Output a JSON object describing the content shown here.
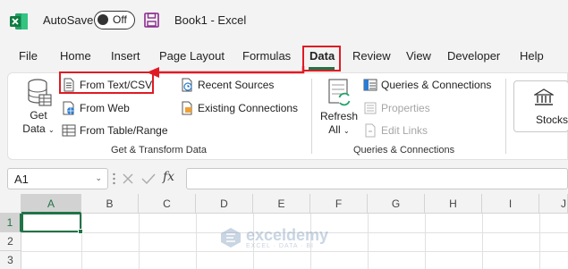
{
  "titlebar": {
    "autosave_label": "AutoSave",
    "autosave_state": "Off",
    "document_title": "Book1  -  Excel"
  },
  "tabs": [
    "File",
    "Home",
    "Insert",
    "Page Layout",
    "Formulas",
    "Data",
    "Review",
    "View",
    "Developer",
    "Help"
  ],
  "active_tab": "Data",
  "ribbon": {
    "get_transform": {
      "get_data_line1": "Get",
      "get_data_line2": "Data",
      "from_text_csv": "From Text/CSV",
      "from_web": "From Web",
      "from_table_range": "From Table/Range",
      "recent_sources": "Recent Sources",
      "existing_connections": "Existing Connections",
      "group_label": "Get & Transform Data"
    },
    "queries": {
      "refresh_line1": "Refresh",
      "refresh_line2": "All",
      "queries_connections": "Queries & Connections",
      "properties": "Properties",
      "edit_links": "Edit Links",
      "group_label": "Queries & Connections"
    },
    "data_types": {
      "stocks": "Stocks"
    }
  },
  "formula_bar": {
    "name_box": "A1",
    "formula_value": ""
  },
  "grid": {
    "columns": [
      "A",
      "B",
      "C",
      "D",
      "E",
      "F",
      "G",
      "H",
      "I",
      "J"
    ],
    "rows": [
      "1",
      "2",
      "3"
    ],
    "selected_cell": "A1"
  },
  "watermark": {
    "name": "exceldemy",
    "tagline": "EXCEL · DATA · BI"
  },
  "colors": {
    "excel_green": "#217346",
    "highlight_red": "#e01b24"
  }
}
